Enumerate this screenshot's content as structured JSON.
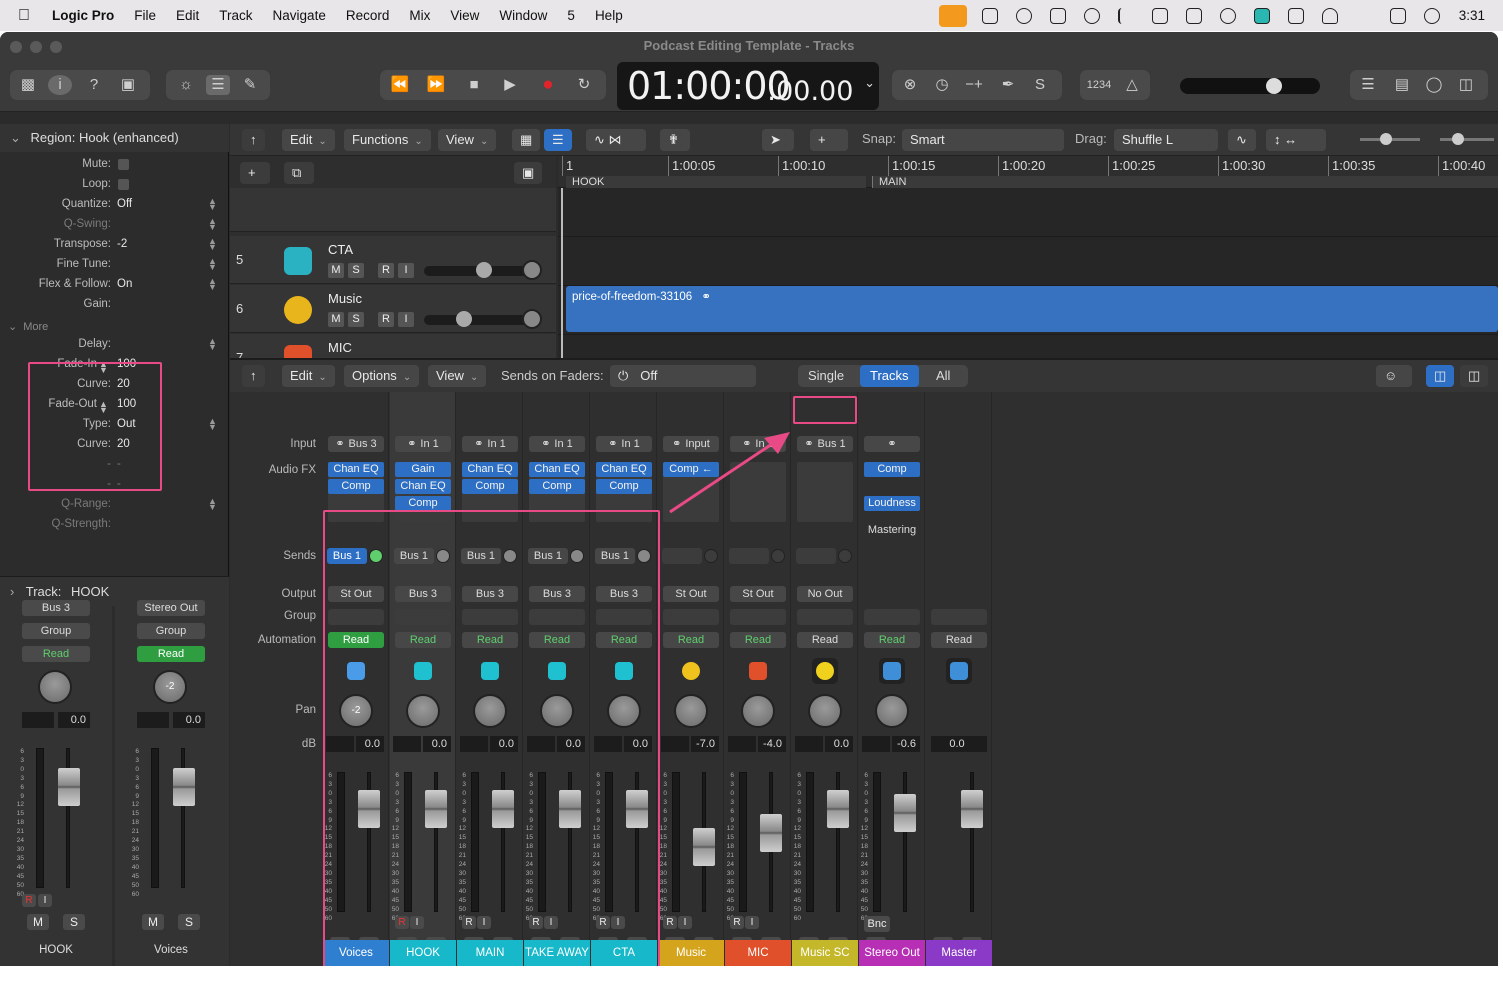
{
  "menubar": {
    "app": "Logic Pro",
    "items": [
      "File",
      "Edit",
      "Track",
      "Navigate",
      "Record",
      "Mix",
      "View",
      "Window",
      "5",
      "Help"
    ],
    "clock": "3:31"
  },
  "window": {
    "title": "Podcast Editing Template - Tracks"
  },
  "transport": {
    "time_main": "01:00:00",
    "time_frac": ":00.00",
    "counter": "1234"
  },
  "inspector": {
    "region_header": "Region: Hook (enhanced)",
    "rows": [
      {
        "label": "Mute:",
        "value": ""
      },
      {
        "label": "Loop:",
        "value": ""
      },
      {
        "label": "Quantize:",
        "value": "Off"
      },
      {
        "label": "Q-Swing:",
        "value": ""
      },
      {
        "label": "Transpose:",
        "value": "-2"
      },
      {
        "label": "Fine Tune:",
        "value": ""
      },
      {
        "label": "Flex & Follow:",
        "value": "On"
      },
      {
        "label": "Gain:",
        "value": ""
      }
    ],
    "more": "More",
    "more_rows": [
      {
        "label": "Delay:",
        "value": ""
      },
      {
        "label": "Fade-In",
        "value": "100"
      },
      {
        "label": "Curve:",
        "value": "20"
      },
      {
        "label": "Fade-Out",
        "value": "100"
      },
      {
        "label": "Type:",
        "value": "Out"
      },
      {
        "label": "Curve:",
        "value": "20"
      },
      {
        "label": "-",
        "value": "-"
      },
      {
        "label": "-",
        "value": "-"
      },
      {
        "label": "Q-Range:",
        "value": ""
      },
      {
        "label": "Q-Strength:",
        "value": ""
      }
    ],
    "track_header_label": "Track:",
    "track_header_name": "HOOK",
    "strips": [
      {
        "output": "Bus 3",
        "group": "Group",
        "auto": "Read",
        "pan": "",
        "db": "0.0",
        "name": "HOOK"
      },
      {
        "output": "Stereo Out",
        "group": "Group",
        "auto": "Read",
        "pan": "-2",
        "db": "0.0",
        "name": "Voices"
      }
    ]
  },
  "tracks_toolbar": {
    "edit": "Edit",
    "functions": "Functions",
    "view": "View",
    "snap_label": "Snap:",
    "snap_value": "Smart",
    "drag_label": "Drag:",
    "drag_value": "Shuffle L"
  },
  "ruler": {
    "marks": [
      "1",
      "1:00:05",
      "1:00:10",
      "1:00:15",
      "1:00:20",
      "1:00:25",
      "1:00:30",
      "1:00:35",
      "1:00:40"
    ],
    "markers": [
      "HOOK",
      "MAIN"
    ]
  },
  "tracks": [
    {
      "num": "5",
      "name": "CTA",
      "icon": "megaphone-icon"
    },
    {
      "num": "6",
      "name": "Music",
      "icon": "music-note-icon"
    },
    {
      "num": "7",
      "name": "MIC",
      "icon": "microphone-icon"
    }
  ],
  "track_buttons": {
    "m": "M",
    "s": "S",
    "r": "R",
    "i": "I"
  },
  "region_name": "price-of-freedom-33106",
  "mixer_toolbar": {
    "edit": "Edit",
    "options": "Options",
    "view": "View",
    "sends_label": "Sends on Faders:",
    "sends_value": "Off",
    "single": "Single",
    "tracks": "Tracks",
    "all": "All"
  },
  "mixer_row_labels": [
    "Input",
    "Audio FX",
    "Sends",
    "Output",
    "Group",
    "Automation",
    "Pan",
    "dB"
  ],
  "channels": [
    {
      "name": "Voices",
      "input": "Bus 3",
      "fx": [
        "Chan EQ",
        "Comp"
      ],
      "send": "Bus 1",
      "output": "St Out",
      "auto": "Read",
      "pan": "-2",
      "db": "0.0",
      "color": "#2f7fd0",
      "icon": "group-people-icon"
    },
    {
      "name": "HOOK",
      "input": "In 1",
      "fx": [
        "Gain",
        "Chan EQ",
        "Comp"
      ],
      "send": "Bus 1",
      "output": "Bus 3",
      "auto": "Read",
      "pan": "",
      "db": "0.0",
      "color": "#17b8c9",
      "icon": "voice-person-icon"
    },
    {
      "name": "MAIN",
      "input": "In 1",
      "fx": [
        "Chan EQ",
        "Comp"
      ],
      "send": "Bus 1",
      "output": "Bus 3",
      "auto": "Read",
      "pan": "",
      "db": "0.0",
      "color": "#17b8c9",
      "icon": "voice-person-icon"
    },
    {
      "name": "TAKE AWAY",
      "input": "In 1",
      "fx": [
        "Chan EQ",
        "Comp"
      ],
      "send": "Bus 1",
      "output": "Bus 3",
      "auto": "Read",
      "pan": "",
      "db": "0.0",
      "color": "#17b8c9",
      "icon": "voice-person-icon"
    },
    {
      "name": "CTA",
      "input": "In 1",
      "fx": [
        "Chan EQ",
        "Comp"
      ],
      "send": "Bus 1",
      "output": "Bus 3",
      "auto": "Read",
      "pan": "",
      "db": "0.0",
      "color": "#17b8c9",
      "icon": "megaphone-icon"
    },
    {
      "name": "Music",
      "input": "Input",
      "fx": [
        "Comp ←"
      ],
      "send": "",
      "output": "St Out",
      "auto": "Read",
      "pan": "",
      "db": "-7.0",
      "color": "#d4a51c",
      "icon": "music-note-icon"
    },
    {
      "name": "MIC",
      "input": "In 1",
      "fx": [],
      "send": "",
      "output": "St Out",
      "auto": "Read",
      "pan": "",
      "db": "-4.0",
      "color": "#e0502a",
      "icon": "microphone-icon"
    },
    {
      "name": "Music SC",
      "input": "Bus 1",
      "fx": [],
      "send": "",
      "output": "No Out",
      "auto": "Read",
      "pan": "",
      "db": "0.0",
      "color": "#c4b82a",
      "icon": "speaker-icon"
    },
    {
      "name": "Stereo Out",
      "input": "",
      "fx": [
        "Comp",
        "Loudness"
      ],
      "fxlabel": "Mastering",
      "send": "",
      "output": "",
      "auto": "Read",
      "pan": "",
      "db": "-0.6",
      "color": "#b72fb4",
      "icon": "waveform-icon",
      "bnc": "Bnc"
    },
    {
      "name": "Master",
      "input": "",
      "fx": [],
      "send": "",
      "output": "",
      "auto": "Read",
      "pan": "",
      "db": "0.0",
      "color": "#8a3ac6",
      "icon": "waveform-icon"
    }
  ],
  "scale_ticks": [
    "6",
    "3",
    "0",
    "3",
    "6",
    "9",
    "12",
    "15",
    "18",
    "21",
    "24",
    "30",
    "35",
    "40",
    "45",
    "50",
    "60"
  ],
  "colors": {
    "accent_pink": "#e84a86",
    "plugin_blue": "#2d6fc4",
    "read_green": "#2f9e41"
  }
}
